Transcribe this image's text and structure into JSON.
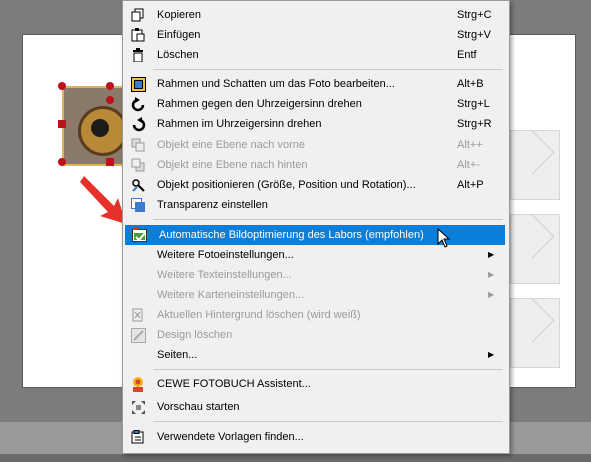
{
  "menu": {
    "items": [
      {
        "label": "Kopieren",
        "shortcut": "Strg+C",
        "icon": "copy-icon"
      },
      {
        "label": "Einfügen",
        "shortcut": "Strg+V",
        "icon": "paste-icon"
      },
      {
        "label": "Löschen",
        "shortcut": "Entf",
        "icon": "trash-icon"
      },
      {
        "label": "Rahmen und Schatten um das Foto bearbeiten...",
        "shortcut": "Alt+B",
        "icon": "frame-icon"
      },
      {
        "label": "Rahmen gegen den Uhrzeigersinn drehen",
        "shortcut": "Strg+L",
        "icon": "rotate-left-icon"
      },
      {
        "label": "Rahmen im Uhrzeigersinn drehen",
        "shortcut": "Strg+R",
        "icon": "rotate-right-icon"
      },
      {
        "label": "Objekt eine Ebene nach vorne",
        "shortcut": "Alt++",
        "icon": "layer-forward-icon"
      },
      {
        "label": "Objekt eine Ebene nach hinten",
        "shortcut": "Alt+-",
        "icon": "layer-backward-icon"
      },
      {
        "label": "Objekt positionieren (Größe, Position und Rotation)...",
        "shortcut": "Alt+P",
        "icon": "position-icon"
      },
      {
        "label": "Transparenz einstellen",
        "shortcut": "",
        "icon": "transparency-icon"
      },
      {
        "label": "Automatische Bildoptimierung des Labors (empfohlen)",
        "shortcut": "",
        "icon": "auto-optimize-icon"
      },
      {
        "label": "Weitere Fotoeinstellungen...",
        "shortcut": "",
        "icon": ""
      },
      {
        "label": "Weitere Texteinstellungen...",
        "shortcut": "",
        "icon": ""
      },
      {
        "label": "Weitere Karteneinstellungen...",
        "shortcut": "",
        "icon": ""
      },
      {
        "label": "Aktuellen Hintergrund löschen (wird weiß)",
        "shortcut": "",
        "icon": "background-delete-icon"
      },
      {
        "label": "Design löschen",
        "shortcut": "",
        "icon": "design-delete-icon"
      },
      {
        "label": "Seiten...",
        "shortcut": "",
        "icon": ""
      },
      {
        "label": "CEWE FOTOBUCH Assistent...",
        "shortcut": "",
        "icon": "assistant-icon"
      },
      {
        "label": "Vorschau starten",
        "shortcut": "",
        "icon": "preview-icon"
      },
      {
        "label": "Verwendete Vorlagen finden...",
        "shortcut": "",
        "icon": "find-templates-icon"
      }
    ]
  },
  "colors": {
    "highlight": "#0a7ed9",
    "handle": "#c0101a",
    "arrow": "#e8302a"
  }
}
